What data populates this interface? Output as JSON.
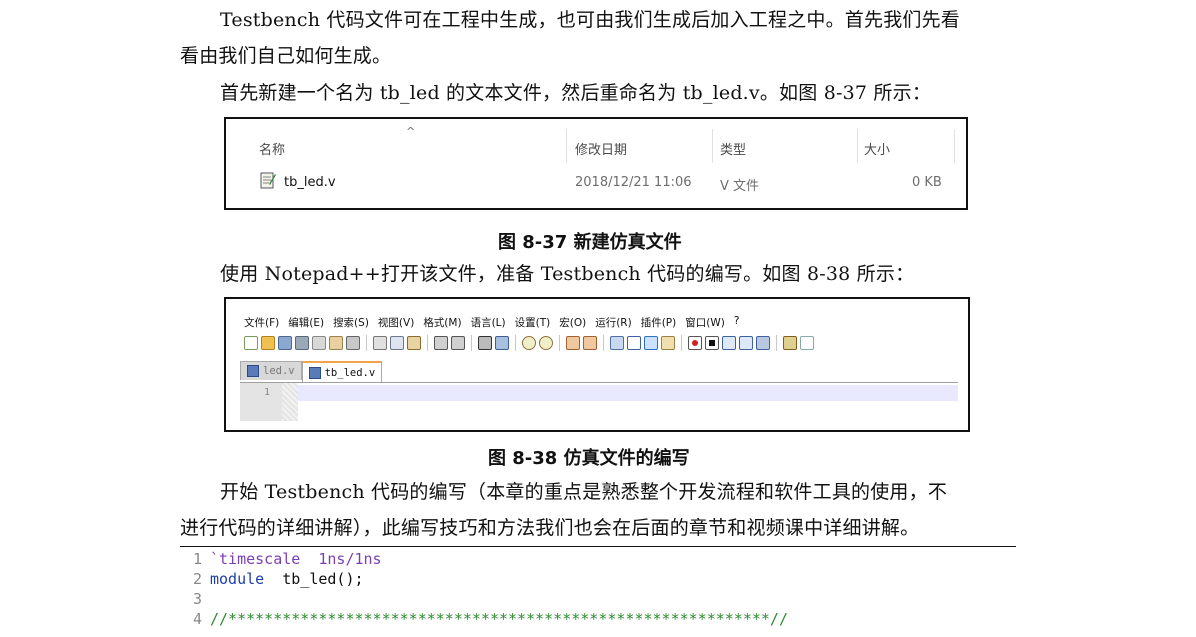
{
  "paragraphs": {
    "p1_line1": "Testbench 代码文件可在工程中生成，也可由我们生成后加入工程之中。首先我们先看",
    "p1_line2": "看由我们自己如何生成。",
    "p2": "首先新建一个名为 tb_led 的文本文件，然后重命名为 tb_led.v。如图 8-37 所示：",
    "p3": "使用 Notepad++打开该文件，准备 Testbench 代码的编写。如图 8-38 所示：",
    "p4_line1": "开始  Testbench 代码的编写（本章的重点是熟悉整个开发流程和软件工具的使用，不",
    "p4_line2": "进行代码的详细讲解），此编写技巧和方法我们也会在后面的章节和视频课中详细讲解。"
  },
  "figure_837": {
    "caption": "图 8-37  新建仿真文件",
    "columns": {
      "name": "名称",
      "date": "修改日期",
      "type": "类型",
      "size": "大小"
    },
    "file": {
      "name": "tb_led.v",
      "date": "2018/12/21 11:06",
      "type": "V 文件",
      "size": "0 KB"
    }
  },
  "figure_838": {
    "caption": "图 8-38  仿真文件的编写",
    "menu": [
      "文件(F)",
      "编辑(E)",
      "搜索(S)",
      "视图(V)",
      "格式(M)",
      "语言(L)",
      "设置(T)",
      "宏(O)",
      "运行(R)",
      "插件(P)",
      "窗口(W)",
      "?"
    ],
    "tabs": [
      {
        "label": "led.v",
        "active": false
      },
      {
        "label": "tb_led.v",
        "active": true
      }
    ],
    "line_number": "1"
  },
  "code": [
    {
      "num": "1",
      "parts": [
        {
          "cls": "str",
          "text": "`timescale  1ns/1ns"
        }
      ]
    },
    {
      "num": "2",
      "parts": [
        {
          "cls": "kw",
          "text": "module"
        },
        {
          "cls": "txt",
          "text": "  tb_led();"
        }
      ]
    },
    {
      "num": "3",
      "parts": []
    },
    {
      "num": "4",
      "parts": [
        {
          "cls": "cm",
          "text": "//************************************************************//"
        }
      ]
    }
  ],
  "colors": {
    "comment": "#2e8b2e",
    "keyword": "#1f3fa8",
    "directive": "#7a3fb5",
    "tab_accent": "#f3a24a"
  },
  "toolbar_icons": [
    "new-icon",
    "open-icon",
    "save-icon",
    "save-all-icon",
    "close-icon",
    "close-all-icon",
    "print-icon",
    "cut-icon",
    "copy-icon",
    "paste-icon",
    "undo-icon",
    "redo-icon",
    "find-icon",
    "replace-icon",
    "zoom-in-icon",
    "zoom-out-icon",
    "sync-v-icon",
    "sync-h-icon",
    "wrap-icon",
    "show-all-icon",
    "indent-guide-icon",
    "doc-map-icon",
    "record-icon",
    "stop-icon",
    "play-icon",
    "play-multi-icon",
    "save-macro-icon",
    "launch-icon",
    "spellcheck-icon"
  ]
}
